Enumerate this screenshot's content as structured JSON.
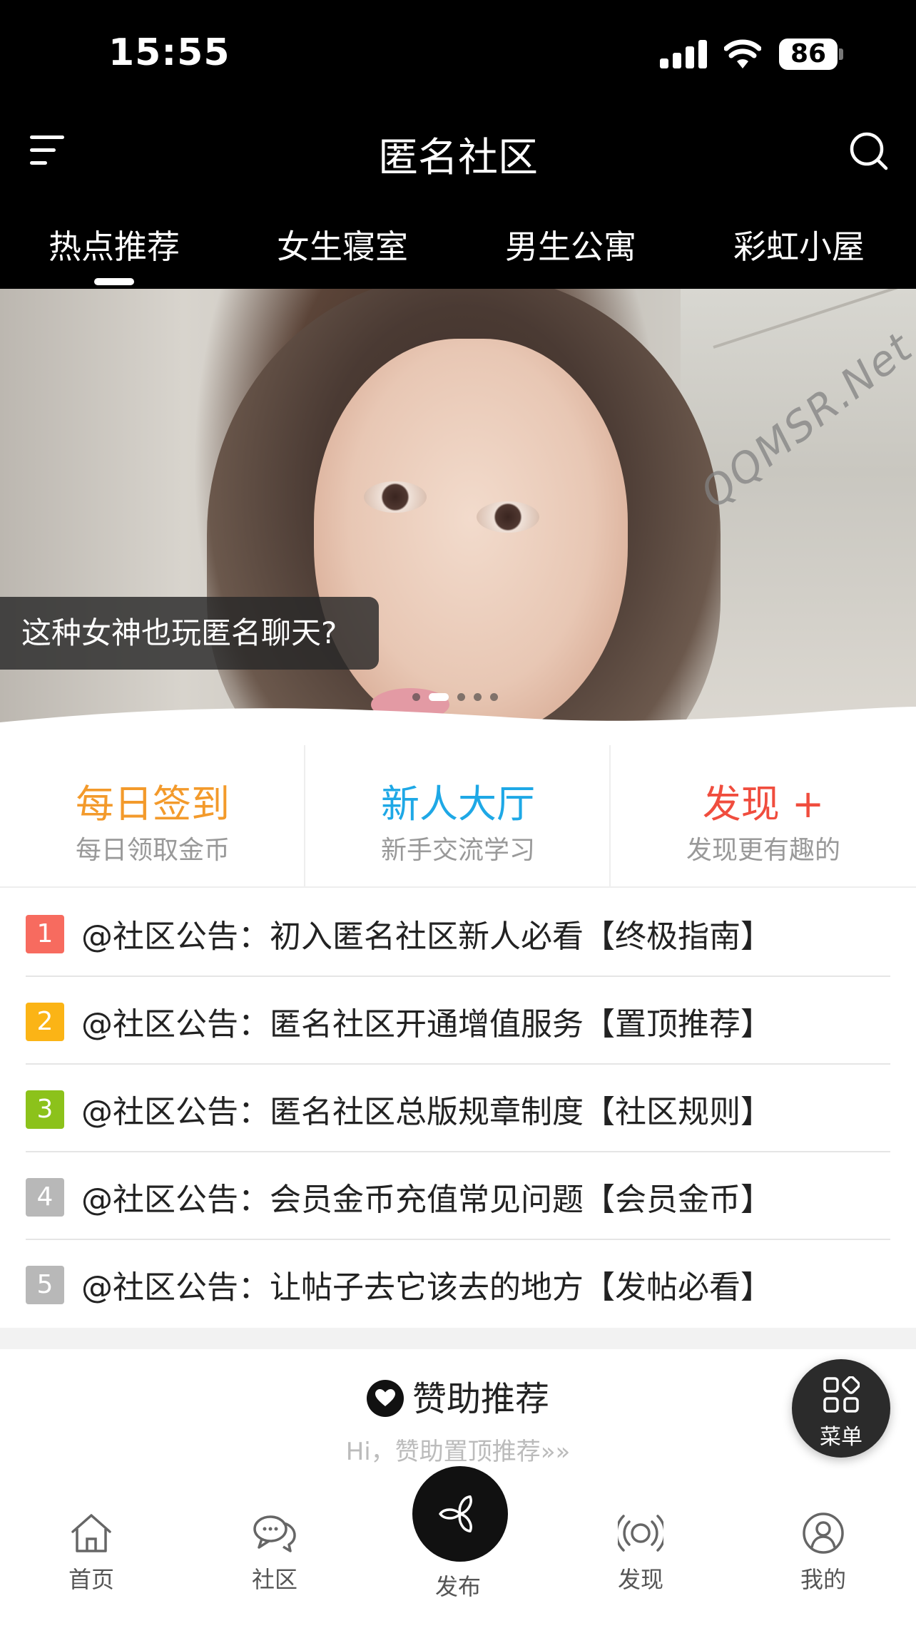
{
  "status_bar": {
    "time": "15:55",
    "battery": "86"
  },
  "header": {
    "title": "匿名社区"
  },
  "tabs": [
    {
      "label": "热点推荐",
      "active": true
    },
    {
      "label": "女生寝室"
    },
    {
      "label": "男生公寓"
    },
    {
      "label": "彩虹小屋"
    }
  ],
  "banner": {
    "caption": "这种女神也玩匿名聊天?",
    "watermark": "QQMSR.Net",
    "slide_count": 5,
    "active_slide": 2
  },
  "quick_entries": [
    {
      "title": "每日签到",
      "subtitle": "每日领取金币",
      "color": "#f39a2b"
    },
    {
      "title": "新人大厅",
      "subtitle": "新手交流学习",
      "color": "#1ea8e6"
    },
    {
      "title": "发现 +",
      "subtitle": "发现更有趣的",
      "color": "#f04d3e"
    }
  ],
  "notices": [
    {
      "num": "1",
      "text": "@社区公告：初入匿名社区新人必看【终极指南】",
      "color": "#f76b5f"
    },
    {
      "num": "2",
      "text": "@社区公告：匿名社区开通增值服务【置顶推荐】",
      "color": "#fbb416"
    },
    {
      "num": "3",
      "text": "@社区公告：匿名社区总版规章制度【社区规则】",
      "color": "#8cc21b"
    },
    {
      "num": "4",
      "text": "@社区公告：会员金币充值常见问题【会员金币】",
      "color": "#b8b8b8"
    },
    {
      "num": "5",
      "text": "@社区公告：让帖子去它该去的地方【发帖必看】",
      "color": "#b8b8b8"
    }
  ],
  "sponsor": {
    "title": "赞助推荐",
    "subtitle": "Hi，赞助置顶推荐»»"
  },
  "float_menu": {
    "label": "菜单"
  },
  "bottom_nav": [
    {
      "label": "首页",
      "icon": "home-icon"
    },
    {
      "label": "社区",
      "icon": "chat-icon"
    },
    {
      "label": "发布",
      "icon": "publish-icon"
    },
    {
      "label": "发现",
      "icon": "broadcast-icon"
    },
    {
      "label": "我的",
      "icon": "user-icon"
    }
  ]
}
